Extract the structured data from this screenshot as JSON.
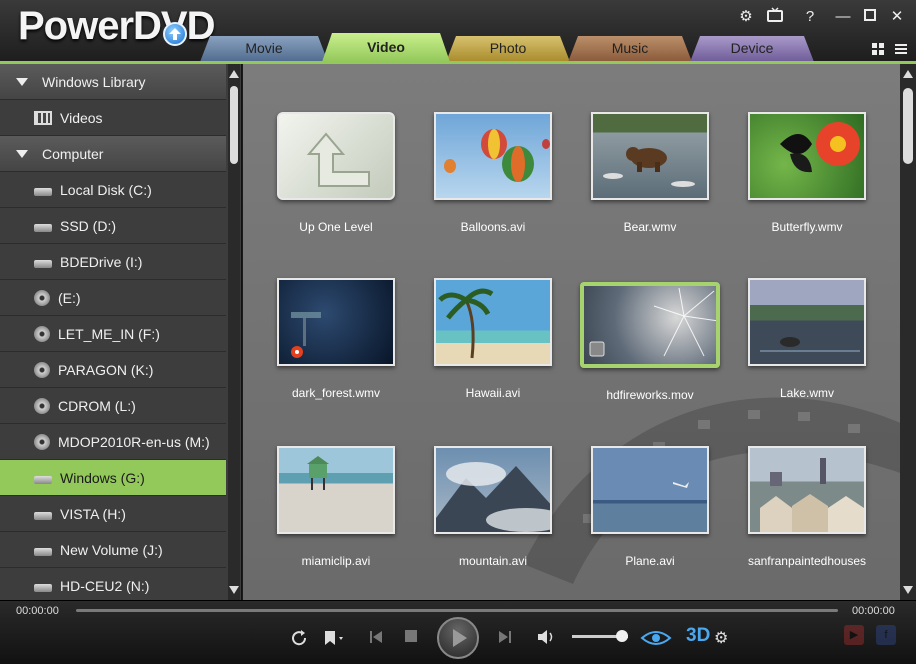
{
  "app": {
    "logo_main": "PowerDVD"
  },
  "tabs": [
    "Movie",
    "Video",
    "Photo",
    "Music",
    "Device"
  ],
  "active_tab": "Video",
  "sidebar": {
    "groups": [
      {
        "label": "Windows Library"
      },
      {
        "label": "Computer"
      }
    ],
    "items": [
      {
        "label": "Videos",
        "icon": "film-icon"
      },
      {
        "label": "Local Disk (C:)",
        "icon": "hard-drive-icon"
      },
      {
        "label": "SSD (D:)",
        "icon": "hard-drive-icon"
      },
      {
        "label": "BDEDrive (I:)",
        "icon": "hard-drive-icon"
      },
      {
        "label": "(E:)",
        "icon": "disc-icon"
      },
      {
        "label": "LET_ME_IN (F:)",
        "icon": "disc-icon"
      },
      {
        "label": "PARAGON (K:)",
        "icon": "disc-icon"
      },
      {
        "label": "CDROM (L:)",
        "icon": "disc-icon"
      },
      {
        "label": "MDOP2010R-en-us (M:)",
        "icon": "disc-icon"
      },
      {
        "label": "Windows (G:)",
        "icon": "hard-drive-icon"
      },
      {
        "label": "VISTA (H:)",
        "icon": "hard-drive-icon"
      },
      {
        "label": "New Volume (J:)",
        "icon": "hard-drive-icon"
      },
      {
        "label": "HD-CEU2 (N:)",
        "icon": "hard-drive-icon"
      }
    ],
    "selected_item": "Windows (G:)"
  },
  "files": [
    {
      "label": "Up One Level",
      "kind": "up"
    },
    {
      "label": "Balloons.avi",
      "kind": "balloons"
    },
    {
      "label": "Bear.wmv",
      "kind": "bear"
    },
    {
      "label": "Butterfly.wmv",
      "kind": "butterfly"
    },
    {
      "label": "dark_forest.wmv",
      "kind": "forest"
    },
    {
      "label": "Hawaii.avi",
      "kind": "hawaii"
    },
    {
      "label": "hdfireworks.mov",
      "kind": "fireworks"
    },
    {
      "label": "Lake.wmv",
      "kind": "lake"
    },
    {
      "label": "miamiclip.avi",
      "kind": "beach"
    },
    {
      "label": "mountain.avi",
      "kind": "mountain"
    },
    {
      "label": "Plane.avi",
      "kind": "plane"
    },
    {
      "label": "sanfranpaintedhouses",
      "kind": "houses"
    }
  ],
  "selected_file": "hdfireworks.mov",
  "player": {
    "time_current": "00:00:00",
    "time_total": "00:00:00",
    "three_d_label": "3D",
    "volume_fraction": 0.8
  },
  "colors": {
    "accent": "#93c85b",
    "panel": "#3d3d3d",
    "content_bg": "#747474"
  }
}
